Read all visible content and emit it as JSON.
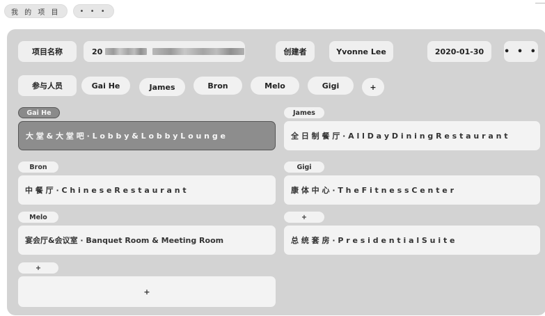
{
  "top": {
    "title": "我 的 项 目",
    "more": "• • •"
  },
  "project": {
    "name_label": "项目名称",
    "name_value": "20",
    "creator_label": "创建者",
    "creator_value": "Yvonne Lee",
    "date": "2020-01-30",
    "more": "• • •"
  },
  "participants": {
    "label": "参与人员",
    "people": [
      "Gai He",
      "James",
      "Bron",
      "Melo",
      "Gigi"
    ],
    "add": "+"
  },
  "areas": [
    {
      "tag": "Gai He",
      "text": "大 堂 & 大 堂 吧  ·  L o b b y  &  L o b b y  L o u n g e",
      "active": true
    },
    {
      "tag": "James",
      "text": "全 日 制 餐 厅  ·  A l l  D a y  D i n i n g  R e s t a u r a n t",
      "active": false
    },
    {
      "tag": "Bron",
      "text": "中  餐  厅   ·   C h i n e s e   R e s t a u r a n t",
      "active": false
    },
    {
      "tag": "Gigi",
      "text": "康 体 中 心   ·   T h e   F i t n e s s   C e n t e r",
      "active": false
    },
    {
      "tag": "Melo",
      "text": "宴会厅&会议室 · Banquet Room & Meeting Room",
      "active": false
    },
    {
      "tag": "+",
      "text": "总  统  套  房   ·   P r e s i d e n t i a l   S u i t e",
      "active": false
    },
    {
      "tag": "+",
      "text": "+",
      "active": false
    }
  ]
}
